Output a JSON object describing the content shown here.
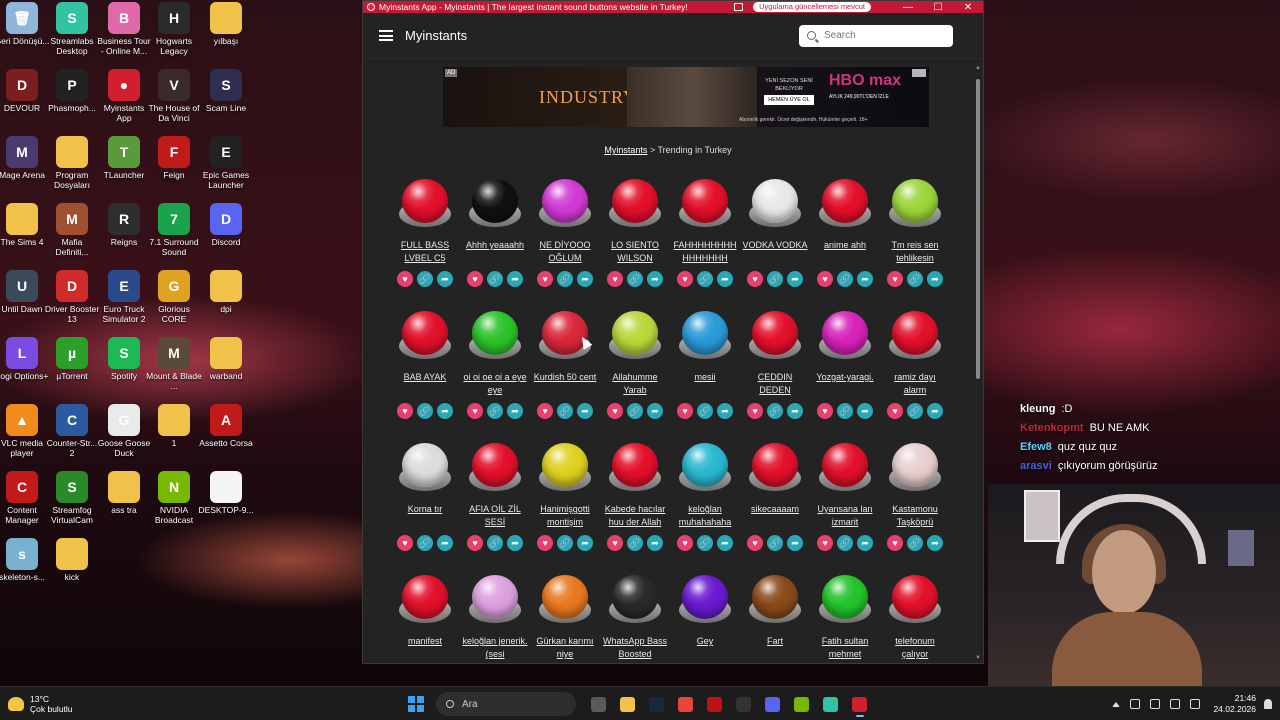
{
  "desktop": {
    "icons": [
      {
        "label": "Geri Dönüşü...",
        "color": "#8fb5d8",
        "glyph": "🗑"
      },
      {
        "label": "Streamlabs Desktop",
        "color": "#32c3a2",
        "glyph": "S"
      },
      {
        "label": "Business Tour - Online M...",
        "color": "#e06aa8",
        "glyph": "B"
      },
      {
        "label": "Hogwarts Legacy",
        "color": "#2b2b2b",
        "glyph": "H"
      },
      {
        "label": "yılbaşı",
        "color": "#f0c24a",
        "glyph": ""
      },
      {
        "label": "DEVOUR",
        "color": "#7a1e1e",
        "glyph": "D"
      },
      {
        "label": "Phasmoph...",
        "color": "#222",
        "glyph": "P"
      },
      {
        "label": "Myinstants App",
        "color": "#d01f2f",
        "glyph": "●"
      },
      {
        "label": "The House of Da Vinci",
        "color": "#3a2a2a",
        "glyph": "V"
      },
      {
        "label": "Scam Line",
        "color": "#2e2e50",
        "glyph": "S"
      },
      {
        "label": "Mage Arena",
        "color": "#4a3a70",
        "glyph": "M"
      },
      {
        "label": "Program Dosyaları",
        "color": "#f0c24a",
        "glyph": ""
      },
      {
        "label": "TLauncher",
        "color": "#5a9a3a",
        "glyph": "T"
      },
      {
        "label": "Feign",
        "color": "#c01a1a",
        "glyph": "F"
      },
      {
        "label": "Epic Games Launcher",
        "color": "#222",
        "glyph": "E"
      },
      {
        "label": "The Sims 4",
        "color": "#f0c24a",
        "glyph": ""
      },
      {
        "label": "Mafia Definiti...",
        "color": "#a05030",
        "glyph": "M"
      },
      {
        "label": "Reigns",
        "color": "#2e2e2e",
        "glyph": "R"
      },
      {
        "label": "7.1 Surround Sound",
        "color": "#1aa34a",
        "glyph": "7"
      },
      {
        "label": "Discord",
        "color": "#5865f2",
        "glyph": "D"
      },
      {
        "label": "Until Dawn",
        "color": "#3a4a5a",
        "glyph": "U"
      },
      {
        "label": "Driver Booster 13",
        "color": "#d02a2a",
        "glyph": "D"
      },
      {
        "label": "Euro Truck Simulator 2",
        "color": "#2a4a8a",
        "glyph": "E"
      },
      {
        "label": "Glorious CORE",
        "color": "#e0a020",
        "glyph": "G"
      },
      {
        "label": "dpi",
        "color": "#f0c24a",
        "glyph": ""
      },
      {
        "label": "Logi Options+",
        "color": "#7b4ae0",
        "glyph": "L"
      },
      {
        "label": "µTorrent",
        "color": "#2aa02a",
        "glyph": "µ"
      },
      {
        "label": "Spotify",
        "color": "#1db954",
        "glyph": "S"
      },
      {
        "label": "Mount & Blade ...",
        "color": "#5a4a3a",
        "glyph": "M"
      },
      {
        "label": "warband",
        "color": "#f0c24a",
        "glyph": ""
      },
      {
        "label": "VLC media player",
        "color": "#f08a1a",
        "glyph": "▲"
      },
      {
        "label": "Counter-Str... 2",
        "color": "#2a5aa0",
        "glyph": "C"
      },
      {
        "label": "Goose Goose Duck",
        "color": "#eaeaea",
        "glyph": "G"
      },
      {
        "label": "1",
        "color": "#f0c24a",
        "glyph": ""
      },
      {
        "label": "Assetto Corsa",
        "color": "#c01a1a",
        "glyph": "A"
      },
      {
        "label": "Content Manager",
        "color": "#c01a1a",
        "glyph": "C"
      },
      {
        "label": "Streamfog VirtualCam",
        "color": "#2a8a2a",
        "glyph": "S"
      },
      {
        "label": "ass tra",
        "color": "#f0c24a",
        "glyph": ""
      },
      {
        "label": "NVIDIA Broadcast",
        "color": "#76b900",
        "glyph": "N"
      },
      {
        "label": "DESKTOP-9...",
        "color": "#f5f5f5",
        "glyph": ""
      },
      {
        "label": "skeleton-s...",
        "color": "#7ab0d0",
        "glyph": "s"
      },
      {
        "label": "kick",
        "color": "#f0c24a",
        "glyph": ""
      }
    ]
  },
  "window": {
    "title": "Myinstants App - Myinstants | The largest instant sound buttons website in Turkey!",
    "update_notice": "Uygulama güncellemesi mevcut",
    "minimize": "—",
    "maximize": "☐",
    "close": "✕"
  },
  "header": {
    "title": "Myinstants",
    "search_placeholder": "Search"
  },
  "ad": {
    "tag": "AD",
    "headline": "INDUSTRY",
    "cta_text": "YENİ SEZON SENİ BEKLİYOR",
    "cta_button": "HEMEN ÜYE OL",
    "brand": "HBO max",
    "brand_sub": "AYLIK 249,90TL'DEN İZLE",
    "fine_print": "Abonelik gerekir. Ücret değişkendir. Hükümler geçerli. 18+"
  },
  "breadcrumb": {
    "root": "Myinstants",
    "separator": ">",
    "current": "Trending in Turkey"
  },
  "sounds": [
    {
      "label": "FULL BASS LVBEL C5",
      "color": "#e3102a"
    },
    {
      "label": "Ahhh yeaaahh",
      "color": "#111111"
    },
    {
      "label": "NE DİYOOO OĞLUM",
      "color": "#d23ad6"
    },
    {
      "label": "LO SIENTO WILSON",
      "color": "#e3102a"
    },
    {
      "label": "FAHHHHHHHH HHHHHHH",
      "color": "#e3102a"
    },
    {
      "label": "VODKA VODKA",
      "color": "#e8e8e8"
    },
    {
      "label": "anime ahh",
      "color": "#e3102a"
    },
    {
      "label": "Tm reis sen tehlikesin",
      "color": "#9ad63a"
    },
    {
      "label": "BAB AYAK",
      "color": "#e3102a"
    },
    {
      "label": "oi oi oe oi a eye eye",
      "color": "#2bc42b"
    },
    {
      "label": "Kurdish 50 cent",
      "color": "#d8283a"
    },
    {
      "label": "Allahumme Yarab",
      "color": "#b8d83a"
    },
    {
      "label": "mesii",
      "color": "#2a9ad8"
    },
    {
      "label": "CEDDIN DEDEN",
      "color": "#e3102a"
    },
    {
      "label": "Yozgat-yaragi.",
      "color": "#d623b8"
    },
    {
      "label": "ramiz dayı alarm",
      "color": "#e3102a"
    },
    {
      "label": "Korna tır",
      "color": "#dcdcdc"
    },
    {
      "label": "AFIA OİL ZİL SESİ",
      "color": "#e3102a"
    },
    {
      "label": "Hanimişgotti montişim",
      "color": "#e0d020"
    },
    {
      "label": "Kabede hacılar huu der Allah",
      "color": "#e3102a"
    },
    {
      "label": "keloğlan muhahahaha",
      "color": "#2ab8d0"
    },
    {
      "label": "sikecaaaam",
      "color": "#e3102a"
    },
    {
      "label": "Uyansana lan izmarit",
      "color": "#e3102a"
    },
    {
      "label": "Kastamonu Taşköprü",
      "color": "#e8cfcf"
    },
    {
      "label": "manifest",
      "color": "#e3102a"
    },
    {
      "label": "keloğlan jenerik. (sesi",
      "color": "#dca0e0"
    },
    {
      "label": "Gürkan karımı niye",
      "color": "#e87820"
    },
    {
      "label": "WhatsApp Bass Boosted",
      "color": "#2a2a2a"
    },
    {
      "label": "Gey",
      "color": "#6a1ad0"
    },
    {
      "label": "Fart",
      "color": "#8a4a1a"
    },
    {
      "label": "Fatih sultan mehmet",
      "color": "#22c42a"
    },
    {
      "label": "telefonum çalıyor",
      "color": "#e3102a"
    }
  ],
  "chat": [
    {
      "user": "kleung",
      "user_color": "#ffffff",
      "message": ":D"
    },
    {
      "user": "Ketenkopmt",
      "user_color": "#c0283a",
      "message": "BU NE AMK"
    },
    {
      "user": "Efew8",
      "user_color": "#60d0ff",
      "message": "quz quz quz"
    },
    {
      "user": "arasvi",
      "user_color": "#4a60e0",
      "message": "çıkıyorum görüşürüz"
    }
  ],
  "taskbar": {
    "weather_temp": "13°C",
    "weather_desc": "Çok bulutlu",
    "search_label": "Ara",
    "time": "21:46",
    "date": "24.02.2026",
    "apps": [
      {
        "name": "file-explorer",
        "color": "#5a5a5a"
      },
      {
        "name": "folder",
        "color": "#f0c24a"
      },
      {
        "name": "steam",
        "color": "#1b2838"
      },
      {
        "name": "chrome",
        "color": "#e8453c"
      },
      {
        "name": "app-red",
        "color": "#c0101a"
      },
      {
        "name": "terminal",
        "color": "#333"
      },
      {
        "name": "discord",
        "color": "#5865f2"
      },
      {
        "name": "nvidia",
        "color": "#76b900"
      },
      {
        "name": "streamlabs",
        "color": "#32c3a2"
      },
      {
        "name": "myinstants",
        "color": "#d01f2f"
      }
    ]
  }
}
